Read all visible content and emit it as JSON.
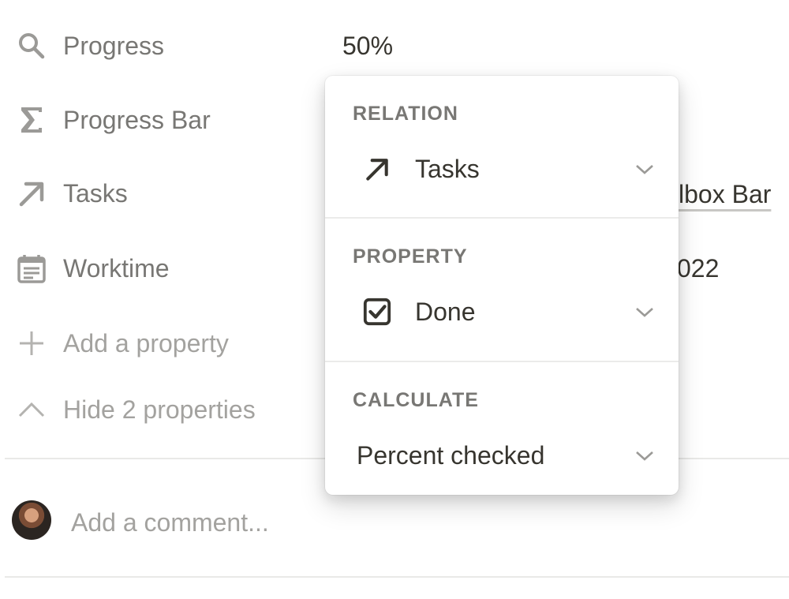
{
  "properties": [
    {
      "icon": "search-icon",
      "label": "Progress"
    },
    {
      "icon": "sigma-icon",
      "label": "Progress Bar"
    },
    {
      "icon": "arrow-up-right-icon",
      "label": "Tasks"
    },
    {
      "icon": "calendar-icon",
      "label": "Worktime"
    }
  ],
  "values": {
    "progress": "50%",
    "tasks_partial": "lbox Bar",
    "worktime_partial": "022"
  },
  "actions": {
    "add_property": "Add a property",
    "hide_properties": "Hide 2 properties"
  },
  "comment": {
    "placeholder": "Add a comment..."
  },
  "popup": {
    "relation": {
      "label": "RELATION",
      "value": "Tasks",
      "icon": "arrow-up-right-icon"
    },
    "property": {
      "label": "PROPERTY",
      "value": "Done",
      "icon": "checkbox-icon"
    },
    "calculate": {
      "label": "CALCULATE",
      "value": "Percent checked"
    }
  },
  "colors": {
    "text": "#37352f",
    "muted": "#787774",
    "placeholder": "#a3a29f",
    "divider": "#e9e9e7"
  }
}
